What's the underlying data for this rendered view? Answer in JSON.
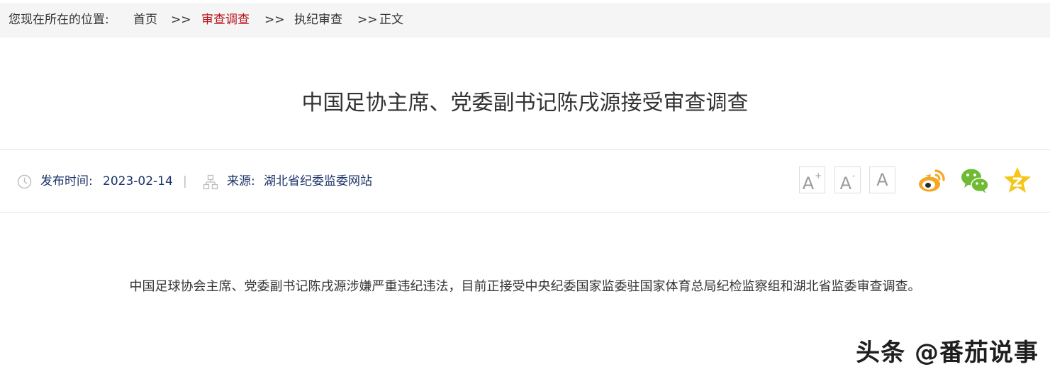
{
  "breadcrumb": {
    "prefix": "您现在所在的位置:",
    "home": "首页",
    "sep1": ">>",
    "section": "审查调查",
    "sep2": ">>",
    "subsection": "执纪审查",
    "sep3": ">>",
    "current": "正文"
  },
  "article": {
    "title": "中国足协主席、党委副书记陈戌源接受审查调查",
    "publish_label": "发布时间:",
    "publish_date": "2023-02-14",
    "divider": "|",
    "source_label": "来源:",
    "source_name": "湖北省纪委监委网站",
    "body": "中国足球协会主席、党委副书记陈戌源涉嫌严重违纪违法，目前正接受中央纪委国家监委驻国家体育总局纪检监察组和湖北省监委审查调查。"
  },
  "font_controls": {
    "letter": "A",
    "increase_mark": "+",
    "decrease_mark": "-"
  },
  "share": {
    "icons": [
      "weibo-icon",
      "wechat-icon",
      "qzone-icon"
    ]
  },
  "watermark": {
    "text": "头条 @番茄说事"
  },
  "colors": {
    "breadcrumb_bg": "#f5f5f5",
    "active_red": "#b8141b",
    "meta_blue": "#1d3368",
    "weibo_orange": "#f5a623",
    "wechat_green": "#6fbb34",
    "qzone_yellow": "#f5c518"
  }
}
